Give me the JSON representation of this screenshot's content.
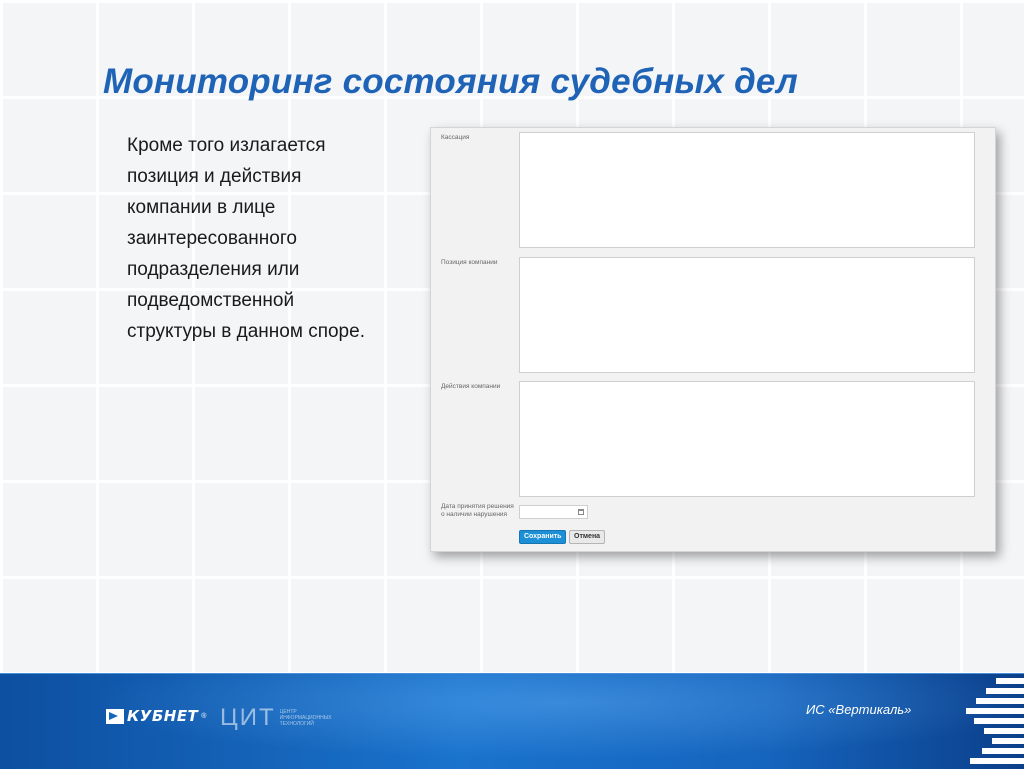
{
  "slide": {
    "title": "Мониторинг состояния судебных дел",
    "body_lines": [
      "Кроме того излагается",
      "позиция и действия",
      "компании в лице",
      "заинтересованного",
      "подразделения или",
      "подведомственной",
      "структуры в данном споре."
    ]
  },
  "form": {
    "fields": [
      {
        "label": "Кассация",
        "value": ""
      },
      {
        "label": "Позиция компании",
        "value": ""
      },
      {
        "label": "Действия компании",
        "value": ""
      }
    ],
    "date_field": {
      "label": "Дата принятия решения о наличии нарушения",
      "value": ""
    },
    "buttons": {
      "save": "Сохранить",
      "cancel": "Отмена"
    }
  },
  "footer": {
    "logo_kubnet": "КУБНЕТ",
    "registered_mark": "®",
    "logo_cit": "ЦИТ",
    "cit_subtitle": "ЦЕНТР ИНФОРМАЦИОННЫХ ТЕХНОЛОГИЙ",
    "caption": "ИС «Вертикаль»"
  },
  "colors": {
    "title": "#1f63b6",
    "footer": "#1a73cc",
    "save_button": "#1c8fd6"
  }
}
